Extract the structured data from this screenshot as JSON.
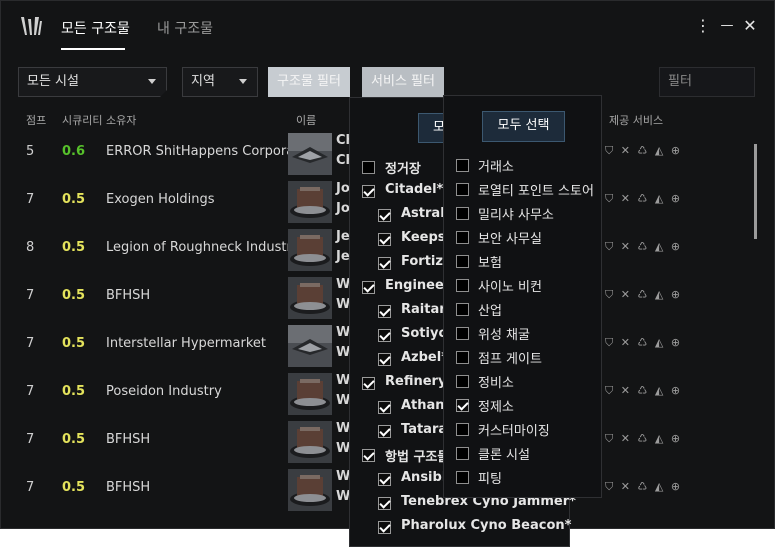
{
  "tabs": [
    {
      "label": "모든 구조물",
      "active": true
    },
    {
      "label": "내 구조물",
      "active": false
    }
  ],
  "window_controls": {
    "menu": "⋮",
    "minimize": "—",
    "close": "✕"
  },
  "filters": {
    "facility_dropdown": "모든 시설",
    "region_dropdown": "지역",
    "structure_filter_button": "구조물 필터",
    "service_filter_button": "서비스 필터",
    "search_placeholder": "필터"
  },
  "columns": {
    "jumps": "점프",
    "security": "시큐리티",
    "owner": "소유자",
    "name": "이름",
    "services": "제공 서비스"
  },
  "colors": {
    "accent": "#3c5870",
    "sec_06": "#57c22b",
    "sec_05": "#e4e35c",
    "background": "#131415"
  },
  "rows": [
    {
      "jumps": "5",
      "security": "0.6",
      "owner": "ERROR ShitHappens Corpora",
      "name1": "Ch",
      "name2": "Ch",
      "thumb": "ship"
    },
    {
      "jumps": "7",
      "security": "0.5",
      "owner": "Exogen Holdings",
      "name1": "Jo",
      "name2": "Jo",
      "thumb": "citadel"
    },
    {
      "jumps": "8",
      "security": "0.5",
      "owner": "Legion of Roughneck Industri",
      "name1": "Je",
      "name2": "Je",
      "thumb": "citadel"
    },
    {
      "jumps": "7",
      "security": "0.5",
      "owner": "BFHSH",
      "name1": "W",
      "name2": "W",
      "thumb": "citadel"
    },
    {
      "jumps": "7",
      "security": "0.5",
      "owner": "Interstellar Hypermarket",
      "name1": "W",
      "name2": "W",
      "thumb": "ship"
    },
    {
      "jumps": "7",
      "security": "0.5",
      "owner": "Poseidon Industry",
      "name1": "W",
      "name2": "W",
      "thumb": "citadel"
    },
    {
      "jumps": "7",
      "security": "0.5",
      "owner": "BFHSH",
      "name1": "W",
      "name2": "W",
      "thumb": "citadel"
    },
    {
      "jumps": "7",
      "security": "0.5",
      "owner": "BFHSH",
      "name1": "W",
      "name2": "W",
      "thumb": "citadel"
    }
  ],
  "structure_popup": {
    "select_all_visible": "모",
    "items": [
      {
        "label": "정거장",
        "checked": false,
        "indent": 0
      },
      {
        "label": "Citadel*",
        "checked": true,
        "indent": 0
      },
      {
        "label": "Astrah",
        "checked": true,
        "indent": 1
      },
      {
        "label": "Keepst",
        "checked": true,
        "indent": 1
      },
      {
        "label": "Fortiza",
        "checked": true,
        "indent": 1
      },
      {
        "label": "Engineer",
        "checked": true,
        "indent": 0
      },
      {
        "label": "Raitaru",
        "checked": true,
        "indent": 1
      },
      {
        "label": "Sotiyo",
        "checked": true,
        "indent": 1
      },
      {
        "label": "Azbel*",
        "checked": true,
        "indent": 1
      },
      {
        "label": "Refinery*",
        "checked": true,
        "indent": 0
      },
      {
        "label": "Athano",
        "checked": true,
        "indent": 1
      },
      {
        "label": "Tatara",
        "checked": true,
        "indent": 1
      },
      {
        "label": "항법 구조물",
        "checked": true,
        "indent": 0
      },
      {
        "label": "Ansibl",
        "checked": true,
        "indent": 1
      },
      {
        "label": "Tenebrex Cyno Jammer*",
        "checked": true,
        "indent": 1
      },
      {
        "label": "Pharolux Cyno Beacon*",
        "checked": true,
        "indent": 1
      }
    ]
  },
  "service_popup": {
    "select_all": "모두 선택",
    "items": [
      {
        "label": "거래소",
        "checked": false
      },
      {
        "label": "로열티 포인트 스토어",
        "checked": false
      },
      {
        "label": "밀리샤 사무소",
        "checked": false
      },
      {
        "label": "보안 사무실",
        "checked": false
      },
      {
        "label": "보험",
        "checked": false
      },
      {
        "label": "사이노 비컨",
        "checked": false
      },
      {
        "label": "산업",
        "checked": false
      },
      {
        "label": "위성 채굴",
        "checked": false
      },
      {
        "label": "점프 게이트",
        "checked": false
      },
      {
        "label": "정비소",
        "checked": false
      },
      {
        "label": "정제소",
        "checked": true
      },
      {
        "label": "커스터마이징",
        "checked": false
      },
      {
        "label": "클론 시설",
        "checked": false
      },
      {
        "label": "피팅",
        "checked": false
      }
    ]
  }
}
